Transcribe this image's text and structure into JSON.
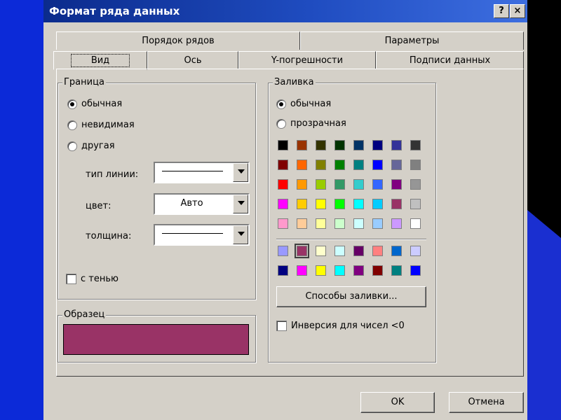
{
  "window": {
    "title": "Формат ряда данных",
    "help_label": "?",
    "close_label": "×"
  },
  "tabs_back": [
    "Порядок рядов",
    "Параметры"
  ],
  "tabs_front": [
    "Вид",
    "Ось",
    "Y-погрешности",
    "Подписи данных"
  ],
  "border": {
    "group_label": "Граница",
    "options": [
      "обычная",
      "невидимая",
      "другая"
    ],
    "selected": "обычная",
    "line_type_label": "тип линии:",
    "color_label": "цвет:",
    "color_value": "Авто",
    "weight_label": "толщина:",
    "shadow_label": "с тенью",
    "shadow_checked": false
  },
  "sample": {
    "group_label": "Образец",
    "color": "#993366"
  },
  "fill": {
    "group_label": "Заливка",
    "options": [
      "обычная",
      "прозрачная"
    ],
    "selected": "обычная",
    "palette_rows": [
      [
        "#000000",
        "#993300",
        "#333300",
        "#003300",
        "#003366",
        "#000080",
        "#333399",
        "#333333"
      ],
      [
        "#800000",
        "#FF6600",
        "#808000",
        "#008000",
        "#008080",
        "#0000FF",
        "#666699",
        "#808080"
      ],
      [
        "#FF0000",
        "#FF9900",
        "#99CC00",
        "#339966",
        "#33CCCC",
        "#3366FF",
        "#800080",
        "#969696"
      ],
      [
        "#FF00FF",
        "#FFCC00",
        "#FFFF00",
        "#00FF00",
        "#00FFFF",
        "#00CCFF",
        "#993366",
        "#C0C0C0"
      ],
      [
        "#FF99CC",
        "#FFCC99",
        "#FFFF99",
        "#CCFFCC",
        "#CCFFFF",
        "#99CCFF",
        "#CC99FF",
        "#FFFFFF"
      ]
    ],
    "chart_rows": [
      [
        "#9999FF",
        "#993366",
        "#FFFFCC",
        "#CCFFFF",
        "#660066",
        "#FF8080",
        "#0066CC",
        "#CCCCFF"
      ],
      [
        "#000080",
        "#FF00FF",
        "#FFFF00",
        "#00FFFF",
        "#800080",
        "#800000",
        "#008080",
        "#0000FF"
      ]
    ],
    "selected_color": "#993366",
    "fill_effects_label": "Способы заливки...",
    "invert_label": "Инверсия для чисел <0",
    "invert_checked": false
  },
  "buttons": {
    "ok": "OK",
    "cancel": "Отмена"
  }
}
